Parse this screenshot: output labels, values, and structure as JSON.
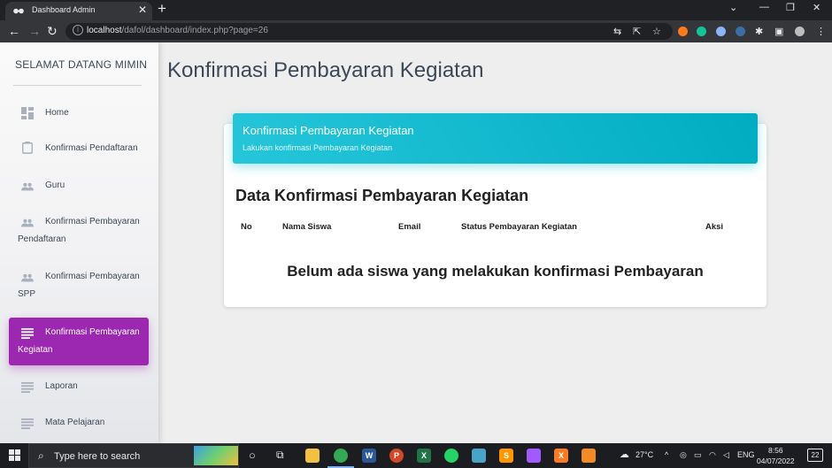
{
  "browser": {
    "tab_title": "Dashboard Admin",
    "tab_close": "✕",
    "new_tab": "+",
    "url_host": "localhost",
    "url_path": "/dafol/dashboard/index.php?page=26"
  },
  "sidebar": {
    "brand": "SELAMAT DATANG MIMIN",
    "items": [
      {
        "label": "Home",
        "icon": "dashboard-icon"
      },
      {
        "label": "Konfirmasi Pendaftaran",
        "icon": "clipboard-icon"
      },
      {
        "label": "Guru",
        "icon": "people-icon"
      },
      {
        "label": "Konfirmasi Pembayaran Pendaftaran",
        "icon": "people-icon"
      },
      {
        "label": "Konfirmasi Pembayaran SPP",
        "icon": "people-icon"
      },
      {
        "label": "Konfirmasi Pembayaran Kegiatan",
        "icon": "list-icon"
      },
      {
        "label": "Laporan",
        "icon": "list-icon"
      },
      {
        "label": "Mata Pelajaran",
        "icon": "list-icon"
      }
    ],
    "active_color": "#9c27b0"
  },
  "main": {
    "page_title": "Konfirmasi Pembayaran Kegiatan",
    "card_header_title": "Konfirmasi Pembayaran Kegiatan",
    "card_header_subtitle": "Lakukan konfirmasi Pembayaran Kegiatan",
    "header_color": "#00acc1",
    "card_title": "Data Konfirmasi Pembayaran Kegiatan",
    "columns": [
      "No",
      "Nama Siswa",
      "Email",
      "Status Pembayaran Kegiatan",
      "Aksi"
    ],
    "empty_message": "Belum ada siswa yang melakukan konfirmasi Pembayaran"
  },
  "taskbar": {
    "search_placeholder": "Type here to search",
    "temperature": "27°C",
    "language": "ENG",
    "time": "8:56",
    "date": "04/07/2022",
    "notifications": "22"
  }
}
